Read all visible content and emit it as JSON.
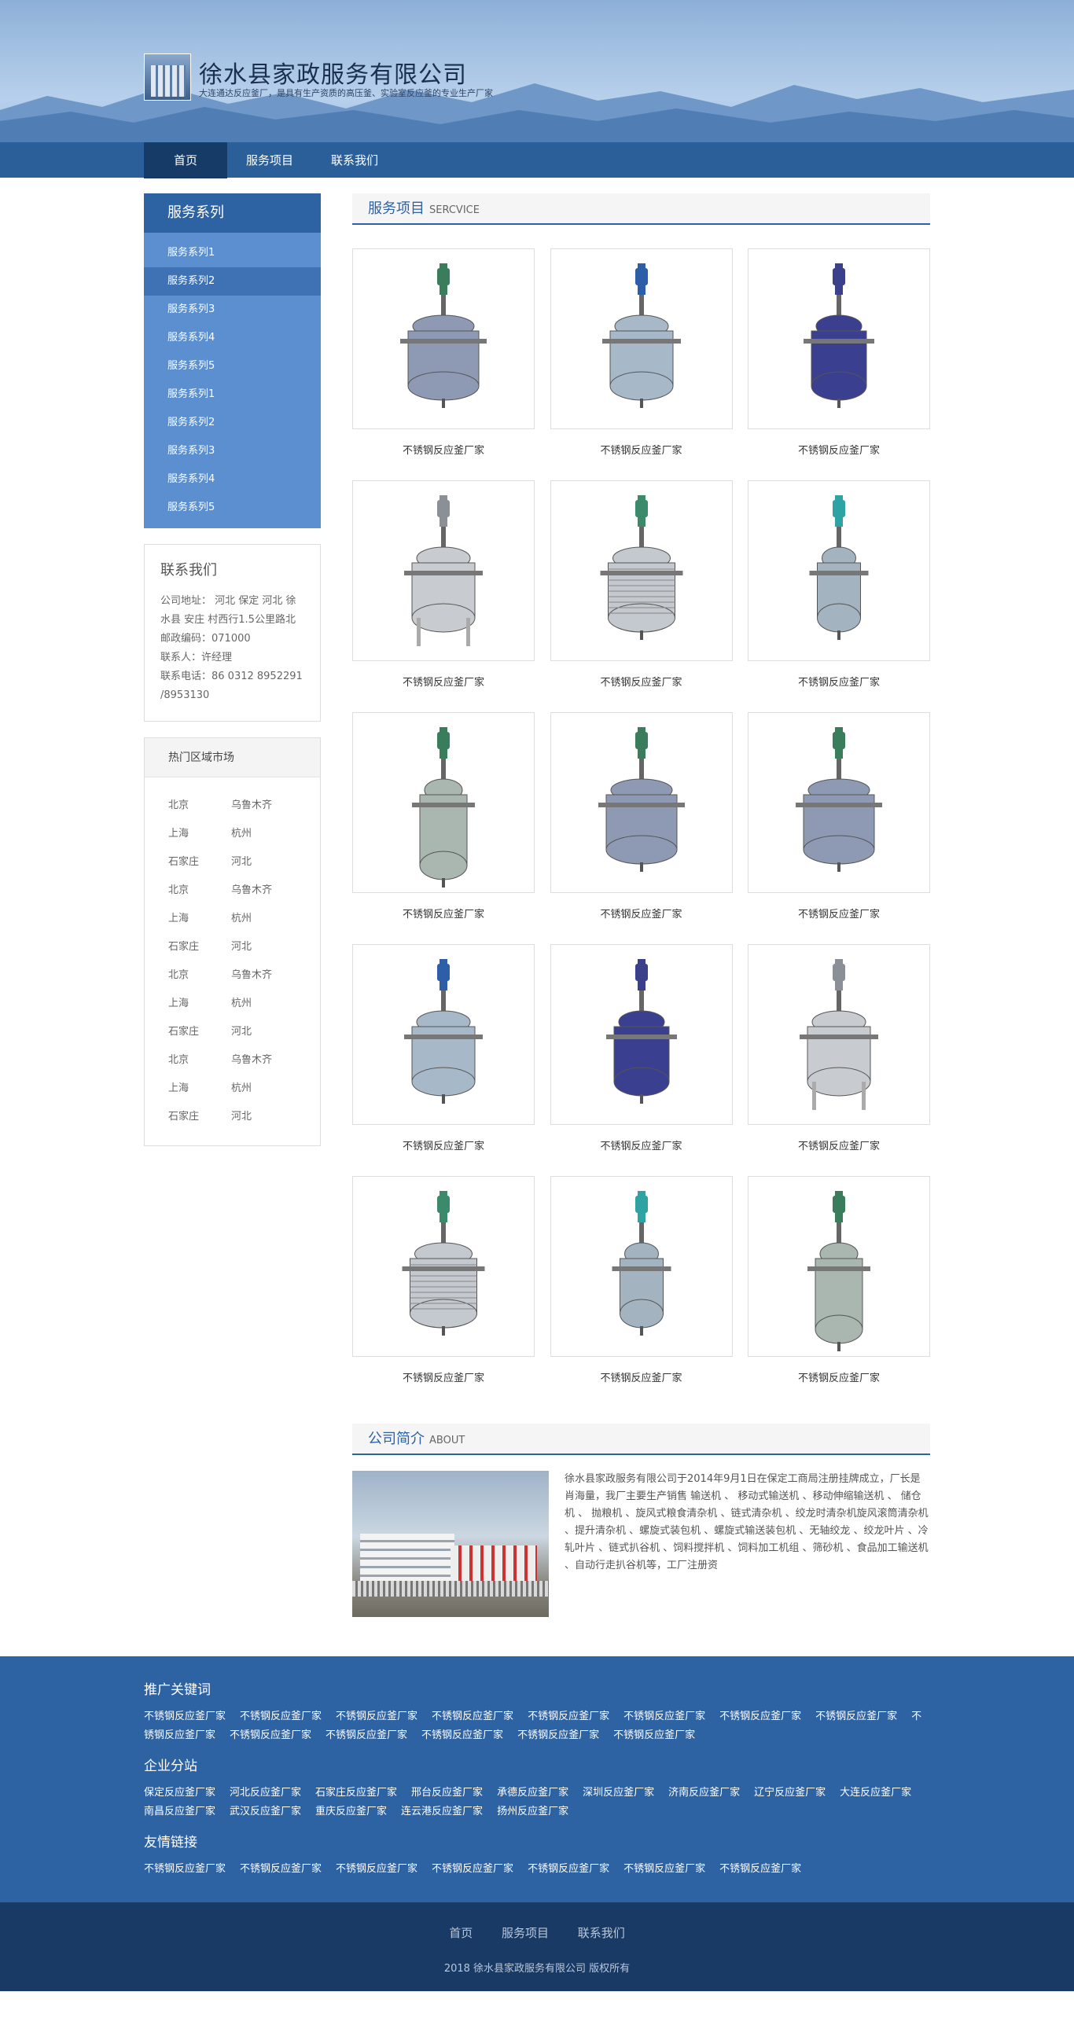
{
  "site": {
    "title": "徐水县家政服务有限公司",
    "desc": "大连通达反应釜厂，是具有生产资质的高压釜、实验室反应釜的专业生产厂家"
  },
  "nav": [
    "首页",
    "服务项目",
    "联系我们"
  ],
  "sidebar": {
    "title": "服务系列",
    "items": [
      "服务系列1",
      "服务系列2",
      "服务系列3",
      "服务系列4",
      "服务系列5",
      "服务系列1",
      "服务系列2",
      "服务系列3",
      "服务系列4",
      "服务系列5"
    ]
  },
  "contact": {
    "title": "联系我们",
    "address": "公司地址： 河北 保定 河北 徐水县 安庄 村西行1.5公里路北",
    "postcode": "邮政编码：071000",
    "person": "联系人：许经理",
    "phone": "联系电话：86 0312 8952291 /8953130"
  },
  "hot": {
    "title": "热门区域市场",
    "cities": [
      "北京",
      "乌鲁木齐",
      "上海",
      "杭州",
      "石家庄",
      "河北",
      "北京",
      "乌鲁木齐",
      "上海",
      "杭州",
      "石家庄",
      "河北",
      "北京",
      "乌鲁木齐",
      "上海",
      "杭州",
      "石家庄",
      "河北",
      "北京",
      "乌鲁木齐",
      "上海",
      "杭州",
      "石家庄",
      "河北"
    ]
  },
  "services": {
    "title_cn": "服务项目",
    "title_en": "SERCVICE",
    "products": [
      {
        "name": "不锈钢反应釜厂家",
        "variant": "blue-motor-green"
      },
      {
        "name": "不锈钢反应釜厂家",
        "variant": "blue-motor-steel"
      },
      {
        "name": "不锈钢反应釜厂家",
        "variant": "purple"
      },
      {
        "name": "不锈钢反应釜厂家",
        "variant": "legs-steel"
      },
      {
        "name": "不锈钢反应釜厂家",
        "variant": "coil-steel"
      },
      {
        "name": "不锈钢反应釜厂家",
        "variant": "small-teal"
      },
      {
        "name": "不锈钢反应釜厂家",
        "variant": "tall-steel"
      },
      {
        "name": "不锈钢反应釜厂家",
        "variant": "blue-motor-green"
      },
      {
        "name": "不锈钢反应釜厂家",
        "variant": "blue-motor-green"
      },
      {
        "name": "不锈钢反应釜厂家",
        "variant": "blue-motor-steel"
      },
      {
        "name": "不锈钢反应釜厂家",
        "variant": "purple"
      },
      {
        "name": "不锈钢反应釜厂家",
        "variant": "legs-steel"
      },
      {
        "name": "不锈钢反应釜厂家",
        "variant": "coil-steel"
      },
      {
        "name": "不锈钢反应釜厂家",
        "variant": "small-teal"
      },
      {
        "name": "不锈钢反应釜厂家",
        "variant": "tall-steel"
      }
    ]
  },
  "about": {
    "title_cn": "公司简介",
    "title_en": "ABOUT",
    "text": "徐水县家政服务有限公司于2014年9月1日在保定工商局注册挂牌成立，厂长是肖海量，我厂主要生产销售 输送机 、 移动式输送机 、移动伸缩输送机 、 储仓机 、 抛粮机 、旋风式粮食清杂机 、链式清杂机 、绞龙时清杂机旋风滚筒清杂机 、提升清杂机 、螺旋式装包机 、螺旋式输送装包机 、无轴绞龙 、绞龙叶片 、冷轧叶片 、链式扒谷机 、饲料搅拌机 、饲料加工机组 、筛砂机 、食品加工输送机 、自动行走扒谷机等，工厂注册资"
  },
  "footer": {
    "keywords_title": "推广关键词",
    "keywords": [
      "不锈钢反应釜厂家",
      "不锈钢反应釜厂家",
      "不锈钢反应釜厂家",
      "不锈钢反应釜厂家",
      "不锈钢反应釜厂家",
      "不锈钢反应釜厂家",
      "不锈钢反应釜厂家",
      "不锈钢反应釜厂家",
      "不锈钢反应釜厂家",
      "不锈钢反应釜厂家",
      "不锈钢反应釜厂家",
      "不锈钢反应釜厂家",
      "不锈钢反应釜厂家",
      "不锈钢反应釜厂家"
    ],
    "branches_title": "企业分站",
    "branches": [
      "保定反应釜厂家",
      "河北反应釜厂家",
      "石家庄反应釜厂家",
      "邢台反应釜厂家",
      "承德反应釜厂家",
      "深圳反应釜厂家",
      "济南反应釜厂家",
      "辽宁反应釜厂家",
      "大连反应釜厂家",
      "南昌反应釜厂家",
      "武汉反应釜厂家",
      "重庆反应釜厂家",
      "连云港反应釜厂家",
      "扬州反应釜厂家"
    ],
    "friends_title": "友情链接",
    "friends": [
      "不锈钢反应釜厂家",
      "不锈钢反应釜厂家",
      "不锈钢反应釜厂家",
      "不锈钢反应釜厂家",
      "不锈钢反应釜厂家",
      "不锈钢反应釜厂家",
      "不锈钢反应釜厂家"
    ],
    "bottom_nav": [
      "首页",
      "服务项目",
      "联系我们"
    ],
    "copyright": "2018 徐水县家政服务有限公司 版权所有"
  }
}
